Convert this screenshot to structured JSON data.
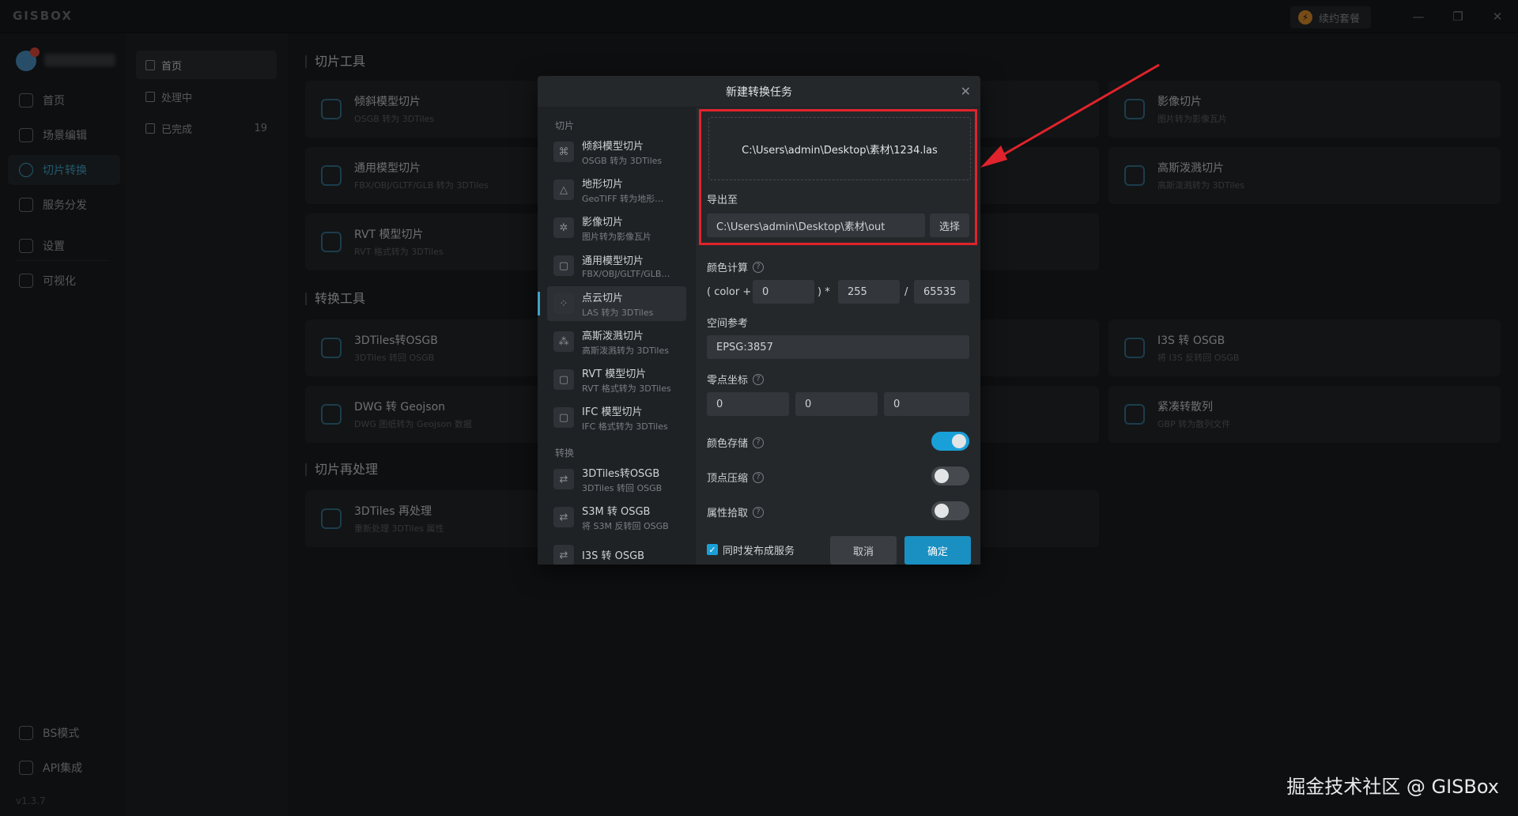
{
  "app": {
    "logo": "GISBOX",
    "renew_label": "续约套餐",
    "version": "v1.3.7"
  },
  "window_controls": {
    "minimize": "—",
    "restore": "❐",
    "close": "✕"
  },
  "sidebar": {
    "items": [
      {
        "label": "首页"
      },
      {
        "label": "场景编辑"
      },
      {
        "label": "切片转换"
      },
      {
        "label": "服务分发"
      },
      {
        "label": "设置"
      },
      {
        "label": "可视化"
      }
    ],
    "bottom": [
      {
        "label": "BS模式"
      },
      {
        "label": "API集成"
      }
    ]
  },
  "subnav": {
    "items": [
      {
        "label": "首页"
      },
      {
        "label": "处理中"
      },
      {
        "label": "已完成",
        "count": "19"
      }
    ]
  },
  "main": {
    "sections": [
      {
        "title": "切片工具"
      },
      {
        "title": "转换工具"
      },
      {
        "title": "切片再处理"
      }
    ],
    "cards": [
      {
        "title": "倾斜模型切片",
        "sub": "OSGB 转为 3DTiles"
      },
      {
        "title": "通用模型切片",
        "sub": "FBX/OBJ/GLTF/GLB 转为 3DTiles"
      },
      {
        "title": "RVT 模型切片",
        "sub": "RVT 格式转为 3DTiles"
      },
      {
        "title": "影像切片",
        "sub": "图片转为影像瓦片"
      },
      {
        "title": "高斯泼溅切片",
        "sub": "高斯泼溅转为 3DTiles"
      },
      {
        "title": "3DTiles转OSGB",
        "sub": "3DTiles 转回 OSGB"
      },
      {
        "title": "DWG 转 Geojson",
        "sub": "DWG 图纸转为 Geojson 数据"
      },
      {
        "title": "I3S 转 OSGB",
        "sub": "将 I3S 反转回 OSGB"
      },
      {
        "title": "紧凑转散列",
        "sub": "GBP 转为散列文件"
      },
      {
        "title": "3DTiles 再处理",
        "sub": "重新处理 3DTiles 属性"
      }
    ]
  },
  "dialog": {
    "title": "新建转换任务",
    "close": "✕",
    "groups": [
      {
        "title": "切片"
      },
      {
        "title": "转换"
      }
    ],
    "tools": [
      {
        "name": "倾斜模型切片",
        "sub": "OSGB 转为 3DTiles"
      },
      {
        "name": "地形切片",
        "sub": "GeoTIFF 转为地形…"
      },
      {
        "name": "影像切片",
        "sub": "图片转为影像瓦片"
      },
      {
        "name": "通用模型切片",
        "sub": "FBX/OBJ/GLTF/GLB…"
      },
      {
        "name": "点云切片",
        "sub": "LAS 转为 3DTiles"
      },
      {
        "name": "高斯泼溅切片",
        "sub": "高斯泼溅转为 3DTiles"
      },
      {
        "name": "RVT 模型切片",
        "sub": "RVT 格式转为 3DTiles"
      },
      {
        "name": "IFC 模型切片",
        "sub": "IFC 格式转为 3DTiles"
      },
      {
        "name": "3DTiles转OSGB",
        "sub": "3DTiles 转回 OSGB"
      },
      {
        "name": "S3M 转 OSGB",
        "sub": "将 S3M 反转回 OSGB"
      },
      {
        "name": "I3S 转 OSGB",
        "sub": ""
      }
    ],
    "input_file": "C:\\Users\\admin\\Desktop\\素材\\1234.las",
    "export_label": "导出至",
    "export_path": "C:\\Users\\admin\\Desktop\\素材\\out",
    "select_button": "选择",
    "color_calc_label": "颜色计算",
    "color_prefix": "( color +",
    "color_add": "0",
    "color_mul_sym": ") *",
    "color_mul": "255",
    "color_div_sym": "/",
    "color_div": "65535",
    "spatial_ref_label": "空间参考",
    "spatial_ref": "EPSG:3857",
    "origin_label": "零点坐标",
    "origin": [
      "0",
      "0",
      "0"
    ],
    "color_store_label": "颜色存储",
    "color_store_on": true,
    "vertex_compress_label": "顶点压缩",
    "vertex_compress_on": false,
    "attr_pick_label": "属性拾取",
    "attr_pick_on": false,
    "publish_label": "同时发布成服务",
    "publish_checked": true,
    "cancel_button": "取消",
    "ok_button": "确定",
    "help_glyph": "?"
  },
  "watermark": "掘金技术社区 @ GISBox",
  "colors": {
    "accent": "#1aa0d8",
    "highlight_box": "#e0232c",
    "arrow": "#e0232c"
  }
}
